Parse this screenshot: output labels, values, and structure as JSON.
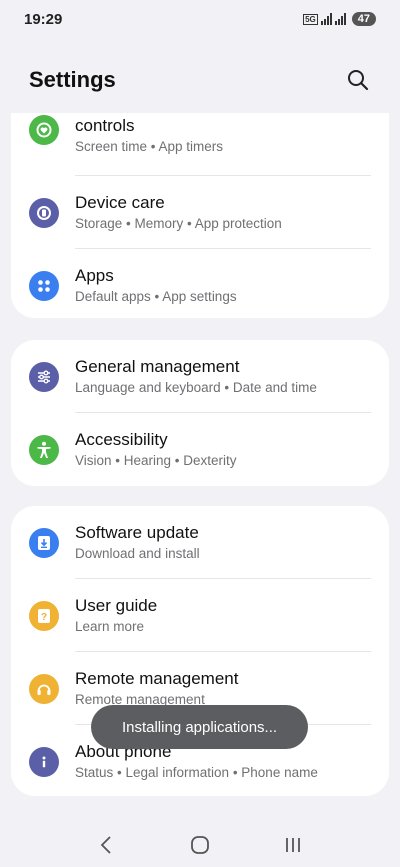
{
  "status": {
    "time": "19:29",
    "network": "5G",
    "battery": "47"
  },
  "header": {
    "title": "Settings"
  },
  "cards": [
    {
      "items": [
        {
          "title": "controls",
          "subtitle": "Screen time  •  App timers",
          "icon": "digital-wellbeing-icon",
          "color": "#4cb848"
        },
        {
          "title": "Device care",
          "subtitle": "Storage  •  Memory  •  App protection",
          "icon": "device-care-icon",
          "color": "#5b5fa8"
        },
        {
          "title": "Apps",
          "subtitle": "Default apps  •  App settings",
          "icon": "apps-icon",
          "color": "#3a7ff0"
        }
      ]
    },
    {
      "items": [
        {
          "title": "General management",
          "subtitle": "Language and keyboard  •  Date and time",
          "icon": "general-management-icon",
          "color": "#5b5fa8"
        },
        {
          "title": "Accessibility",
          "subtitle": "Vision  •  Hearing  •  Dexterity",
          "icon": "accessibility-icon",
          "color": "#4cb848"
        }
      ]
    },
    {
      "items": [
        {
          "title": "Software update",
          "subtitle": "Download and install",
          "icon": "software-update-icon",
          "color": "#3a7ff0"
        },
        {
          "title": "User guide",
          "subtitle": "Learn more",
          "icon": "user-guide-icon",
          "color": "#f0b233"
        },
        {
          "title": "Remote management",
          "subtitle": "Remote management",
          "icon": "remote-management-icon",
          "color": "#f0b233"
        },
        {
          "title": "About phone",
          "subtitle": "Status  •  Legal information  •  Phone name",
          "icon": "about-phone-icon",
          "color": "#5b5fa8"
        }
      ]
    }
  ],
  "toast": {
    "text": "Installing applications..."
  }
}
